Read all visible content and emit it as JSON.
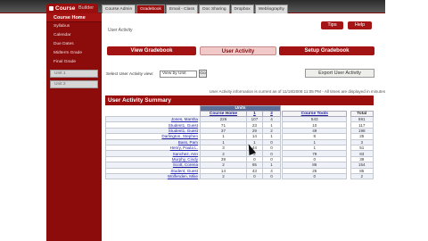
{
  "header": {
    "course_tab": "Course",
    "builder_tab": "Builder"
  },
  "top_tabs": [
    "Course Admin",
    "Gradebook",
    "Email - Class",
    "Doc Sharing",
    "Dropbox",
    "Webliography"
  ],
  "sidebar": {
    "home": "Course Home",
    "items": [
      "Syllabus",
      "Calendar",
      "Due Dates",
      "Midterm Grade",
      "Final Grade"
    ],
    "units": [
      "Unit 1",
      "Unit 2"
    ]
  },
  "breadcrumb": "User Activity",
  "help_buttons": {
    "tips": "Tips",
    "help": "Help"
  },
  "nav": {
    "view_gradebook": "View Gradebook",
    "user_activity": "User Activity",
    "setup_gradebook": "Setup Gradebook"
  },
  "controls": {
    "view_label": "Select User Activity view:",
    "view_value": "View by Unit",
    "go": "Go",
    "export": "Export User Activity"
  },
  "info_text": "User Activity information is current as of 11/18/2008 11:05 PM - All times are displayed in minutes",
  "summary": {
    "title": "User Activity Summary",
    "units_header": "Units",
    "columns": [
      "Course Home",
      "1",
      "2",
      "Course Tools",
      "Total"
    ],
    "rows": [
      {
        "name": "Jones, Marsha",
        "values": [
          "226",
          "107",
          "4",
          "543",
          "881"
        ]
      },
      {
        "name": "Student1, Guest",
        "values": [
          "71",
          "23",
          "1",
          "10",
          "117"
        ]
      },
      {
        "name": "Student1, Guest",
        "values": [
          "37",
          "29",
          "2",
          "49",
          "198"
        ]
      },
      {
        "name": "Darlington, Stephen",
        "values": [
          "1",
          "14",
          "1",
          "8",
          "25"
        ]
      },
      {
        "name": "Bass, Pam",
        "values": [
          "1",
          "1",
          "0",
          "1",
          "3"
        ]
      },
      {
        "name": "Henry, Paula L.",
        "values": [
          "3",
          "44",
          "0",
          "1",
          "51"
        ]
      },
      {
        "name": "Sanchez, Ann",
        "values": [
          "2",
          "2",
          "0",
          "79",
          "83"
        ]
      },
      {
        "name": "Murphy, Cindy",
        "values": [
          "39",
          "0",
          "0",
          "0",
          "39"
        ]
      },
      {
        "name": "Scott, Corena",
        "values": [
          "2",
          "65",
          "1",
          "86",
          "154"
        ]
      },
      {
        "name": "Student, Guest",
        "values": [
          "14",
          "43",
          "4",
          "25",
          "85"
        ]
      },
      {
        "name": "Wolfenden, Mike",
        "values": [
          "2",
          "0",
          "0",
          "0",
          "2"
        ]
      }
    ]
  }
}
